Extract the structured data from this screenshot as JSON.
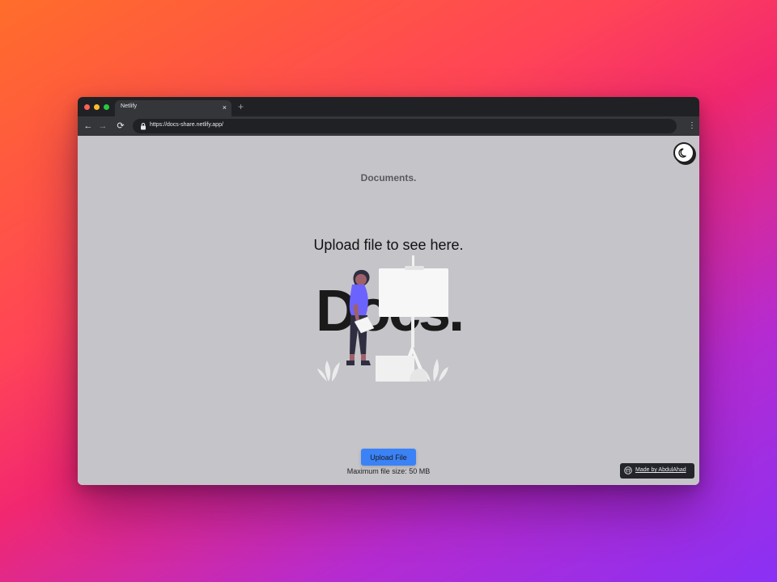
{
  "browser": {
    "tab_title": "Netlify",
    "tab_close_glyph": "×",
    "new_tab_glyph": "+",
    "url": "https://docs-share.netlify.app/",
    "back_glyph": "←",
    "forward_glyph": "→",
    "reload_glyph": "⟳",
    "menu_glyph": "⋮"
  },
  "page": {
    "brand": "Documents.",
    "empty_title": "Upload file to see here.",
    "illustration_word": "Docs.",
    "upload_button": "Upload File",
    "max_size": "Maximum file size: 50 MB",
    "credit": "Made by AbdulAhad"
  },
  "icons": {
    "theme_toggle": "moon-icon",
    "lock": "lock-icon",
    "credit": "github-icon"
  },
  "colors": {
    "page_background": "#c5c4c9",
    "button": "#3b82f6",
    "figure_shirt": "#6c63ff",
    "chrome_dark": "#202124"
  }
}
